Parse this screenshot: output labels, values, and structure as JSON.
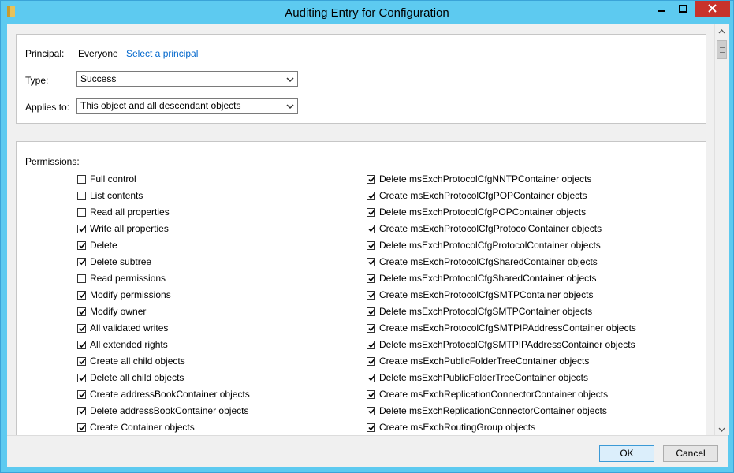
{
  "window": {
    "title": "Auditing Entry for Configuration"
  },
  "principal": {
    "label": "Principal:",
    "value": "Everyone",
    "select_link": "Select a principal"
  },
  "type": {
    "label": "Type:",
    "value": "Success"
  },
  "applies_to": {
    "label": "Applies to:",
    "value": "This object and all descendant objects"
  },
  "permissions": {
    "label": "Permissions:",
    "left": [
      {
        "label": "Full control",
        "checked": false
      },
      {
        "label": "List contents",
        "checked": false
      },
      {
        "label": "Read all properties",
        "checked": false
      },
      {
        "label": "Write all properties",
        "checked": true
      },
      {
        "label": "Delete",
        "checked": true
      },
      {
        "label": "Delete subtree",
        "checked": true
      },
      {
        "label": "Read permissions",
        "checked": false
      },
      {
        "label": "Modify permissions",
        "checked": true
      },
      {
        "label": "Modify owner",
        "checked": true
      },
      {
        "label": "All validated writes",
        "checked": true
      },
      {
        "label": "All extended rights",
        "checked": true
      },
      {
        "label": "Create all child objects",
        "checked": true
      },
      {
        "label": "Delete all child objects",
        "checked": true
      },
      {
        "label": "Create addressBookContainer objects",
        "checked": true
      },
      {
        "label": "Delete addressBookContainer objects",
        "checked": true
      },
      {
        "label": "Create Container objects",
        "checked": true
      }
    ],
    "right": [
      {
        "label": "Delete msExchProtocolCfgNNTPContainer objects",
        "checked": true
      },
      {
        "label": "Create msExchProtocolCfgPOPContainer objects",
        "checked": true
      },
      {
        "label": "Delete msExchProtocolCfgPOPContainer objects",
        "checked": true
      },
      {
        "label": "Create msExchProtocolCfgProtocolContainer objects",
        "checked": true
      },
      {
        "label": "Delete msExchProtocolCfgProtocolContainer objects",
        "checked": true
      },
      {
        "label": "Create msExchProtocolCfgSharedContainer objects",
        "checked": true
      },
      {
        "label": "Delete msExchProtocolCfgSharedContainer objects",
        "checked": true
      },
      {
        "label": "Create msExchProtocolCfgSMTPContainer objects",
        "checked": true
      },
      {
        "label": "Delete msExchProtocolCfgSMTPContainer objects",
        "checked": true
      },
      {
        "label": "Create msExchProtocolCfgSMTPIPAddressContainer objects",
        "checked": true
      },
      {
        "label": "Delete msExchProtocolCfgSMTPIPAddressContainer objects",
        "checked": true
      },
      {
        "label": "Create msExchPublicFolderTreeContainer objects",
        "checked": true
      },
      {
        "label": "Delete msExchPublicFolderTreeContainer objects",
        "checked": true
      },
      {
        "label": "Create msExchReplicationConnectorContainer objects",
        "checked": true
      },
      {
        "label": "Delete msExchReplicationConnectorContainer objects",
        "checked": true
      },
      {
        "label": "Create msExchRoutingGroup objects",
        "checked": true
      }
    ]
  },
  "buttons": {
    "ok": "OK",
    "cancel": "Cancel"
  },
  "icons": {
    "app": "folder-icon",
    "minimize": "minimize-icon",
    "maximize": "maximize-icon",
    "close": "close-icon"
  },
  "colors": {
    "titlebar": "#5dcaf0",
    "close_button": "#c8332b",
    "link": "#0066cc"
  }
}
